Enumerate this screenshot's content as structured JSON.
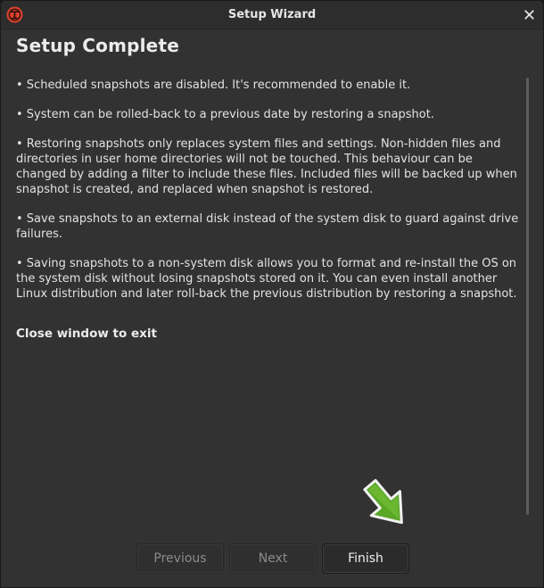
{
  "window": {
    "title": "Setup Wizard",
    "app_icon": "timeshift-app-icon",
    "close_icon": "close-icon"
  },
  "page": {
    "title": "Setup Complete",
    "bullets": [
      "• Scheduled snapshots are disabled. It's recommended to enable it.",
      "• System can be rolled-back to a previous date by restoring a snapshot.",
      "• Restoring snapshots only replaces system files and settings. Non-hidden files and\ndirectories in user home directories will not be touched. This behaviour can be\nchanged by adding a filter to include these files. Included files will be backed up when\nsnapshot is created, and replaced when snapshot is restored.",
      "• Save snapshots to an external disk instead of the system disk to guard against drive\nfailures.",
      "• Saving snapshots to a non-system disk allows you to format and re-install the OS on\nthe system disk without losing snapshots stored on it. You can even install another\nLinux distribution and later roll-back the previous distribution by restoring a snapshot."
    ],
    "closing_note": "Close window to exit"
  },
  "buttons": {
    "previous": "Previous",
    "next": "Next",
    "finish": "Finish"
  },
  "colors": {
    "window_bg": "#323232",
    "accent_red": "#d9432f",
    "arrow_green": "#5aa626"
  }
}
